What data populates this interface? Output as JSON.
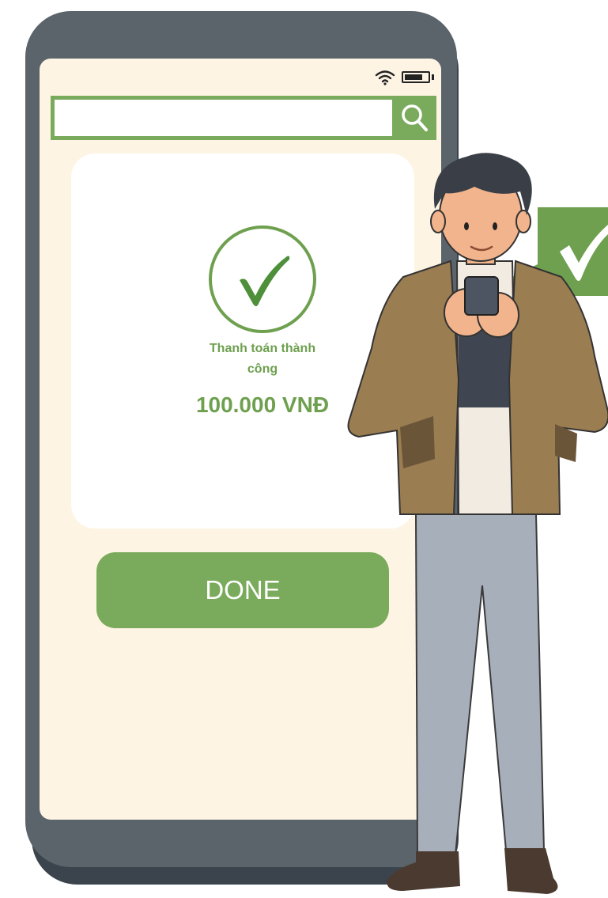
{
  "search": {
    "value": "",
    "placeholder": ""
  },
  "icons": {
    "wifi": "wifi-icon",
    "battery": "battery-icon",
    "search": "search-icon",
    "success_check": "check-icon",
    "bubble_check": "check-icon"
  },
  "payment": {
    "status_line1": "Thanh toán thành",
    "status_line2": "công",
    "amount": "100.000 VNĐ"
  },
  "done_label": "DONE",
  "colors": {
    "accent": "#7aab5c",
    "screen_bg": "#fdf4e3",
    "phone_frame": "#5b636b",
    "card_bg": "#ffffff"
  }
}
